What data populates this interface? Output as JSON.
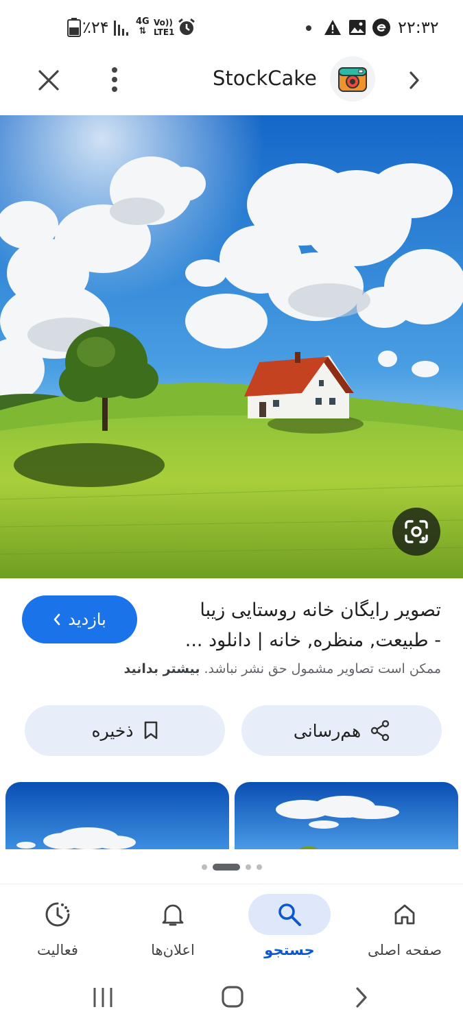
{
  "status_bar": {
    "time": "۲۲:۳۲",
    "battery": "٪۲۴",
    "network_type": "4G",
    "volte": "Vo))",
    "lte": "LTE1"
  },
  "top_bar": {
    "site_name": "StockCake"
  },
  "image": {
    "description_icon": "lens-icon"
  },
  "result": {
    "title_line1": "تصویر رایگان خانه روستایی زیبا",
    "title_line2": "- طبیعت, منظره, خانه | دانلود ...",
    "visit_label": "بازدید",
    "copyright_text": "ممکن است تصاویر مشمول حق نشر نباشد.",
    "learn_more": "بیشتر بدانید",
    "share_label": "هم‌رسانی",
    "save_label": "ذخیره"
  },
  "bottom_nav": {
    "items": [
      {
        "label": "صفحه اصلی",
        "icon": "home-icon",
        "active": false
      },
      {
        "label": "جستجو",
        "icon": "search-icon",
        "active": true
      },
      {
        "label": "اعلان‌ها",
        "icon": "bell-icon",
        "active": false
      },
      {
        "label": "فعالیت",
        "icon": "activity-icon",
        "active": false
      }
    ]
  },
  "colors": {
    "accent": "#1a73e8",
    "pill_bg": "#e8eef9",
    "nav_active_bg": "#dfe8fb"
  }
}
